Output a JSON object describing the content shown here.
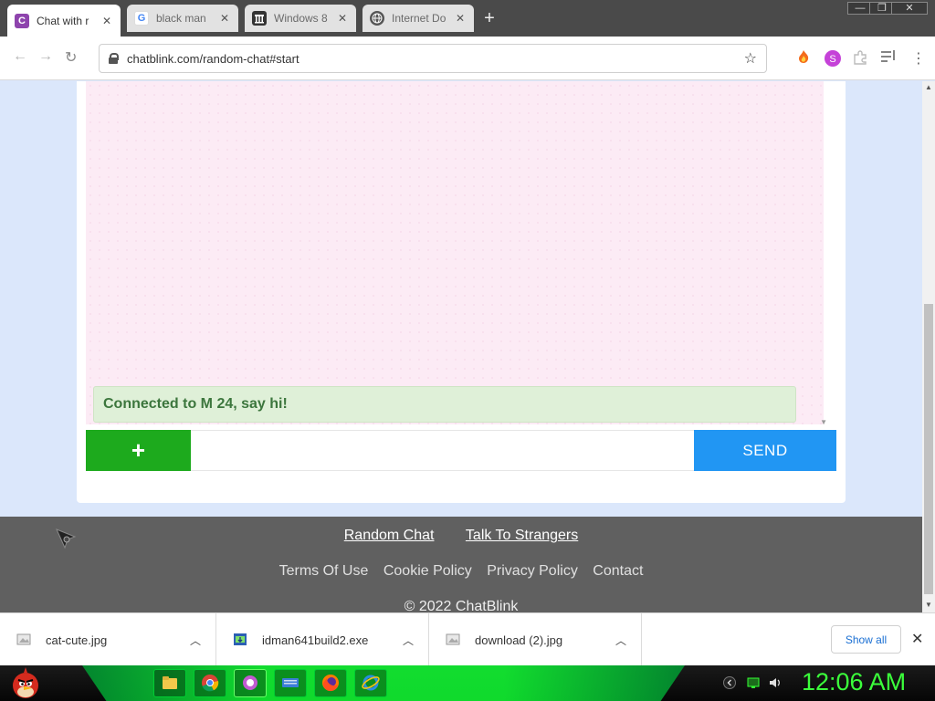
{
  "browser": {
    "tabs": [
      {
        "title": "Chat with r",
        "favicon": "chatblink-icon",
        "color": "#8e44ad",
        "active": true
      },
      {
        "title": "black man",
        "favicon": "google-icon",
        "active": false
      },
      {
        "title": "Windows 8",
        "favicon": "building-icon",
        "active": false
      },
      {
        "title": "Internet Do",
        "favicon": "globe-icon",
        "active": false
      }
    ],
    "new_tab": "+",
    "window_buttons": [
      "—",
      "❐",
      "✕"
    ],
    "url": "chatblink.com/random-chat#start"
  },
  "chat": {
    "system_message": "Connected to M 24, say hi!",
    "plus_label": "+",
    "message_value": "",
    "send_label": "SEND"
  },
  "footer": {
    "primary_links": [
      "Random Chat",
      "Talk To Strangers"
    ],
    "secondary_links": [
      "Terms Of Use",
      "Cookie Policy",
      "Privacy Policy",
      "Contact"
    ],
    "copyright": "© 2022 ChatBlink"
  },
  "downloads": {
    "items": [
      {
        "name": "cat-cute.jpg",
        "icon": "image-file-icon"
      },
      {
        "name": "idman641build2.exe",
        "icon": "exe-file-icon"
      },
      {
        "name": "download (2).jpg",
        "icon": "image-file-icon"
      }
    ],
    "show_all": "Show all"
  },
  "taskbar": {
    "clock": "12:06 AM"
  },
  "colors": {
    "plus_button": "#1daa1d",
    "send_button": "#2196f3",
    "system_message_bg": "#dff0d8",
    "system_message_text": "#3c763d",
    "footer_bg": "#606060",
    "clock": "#3bff3b"
  }
}
